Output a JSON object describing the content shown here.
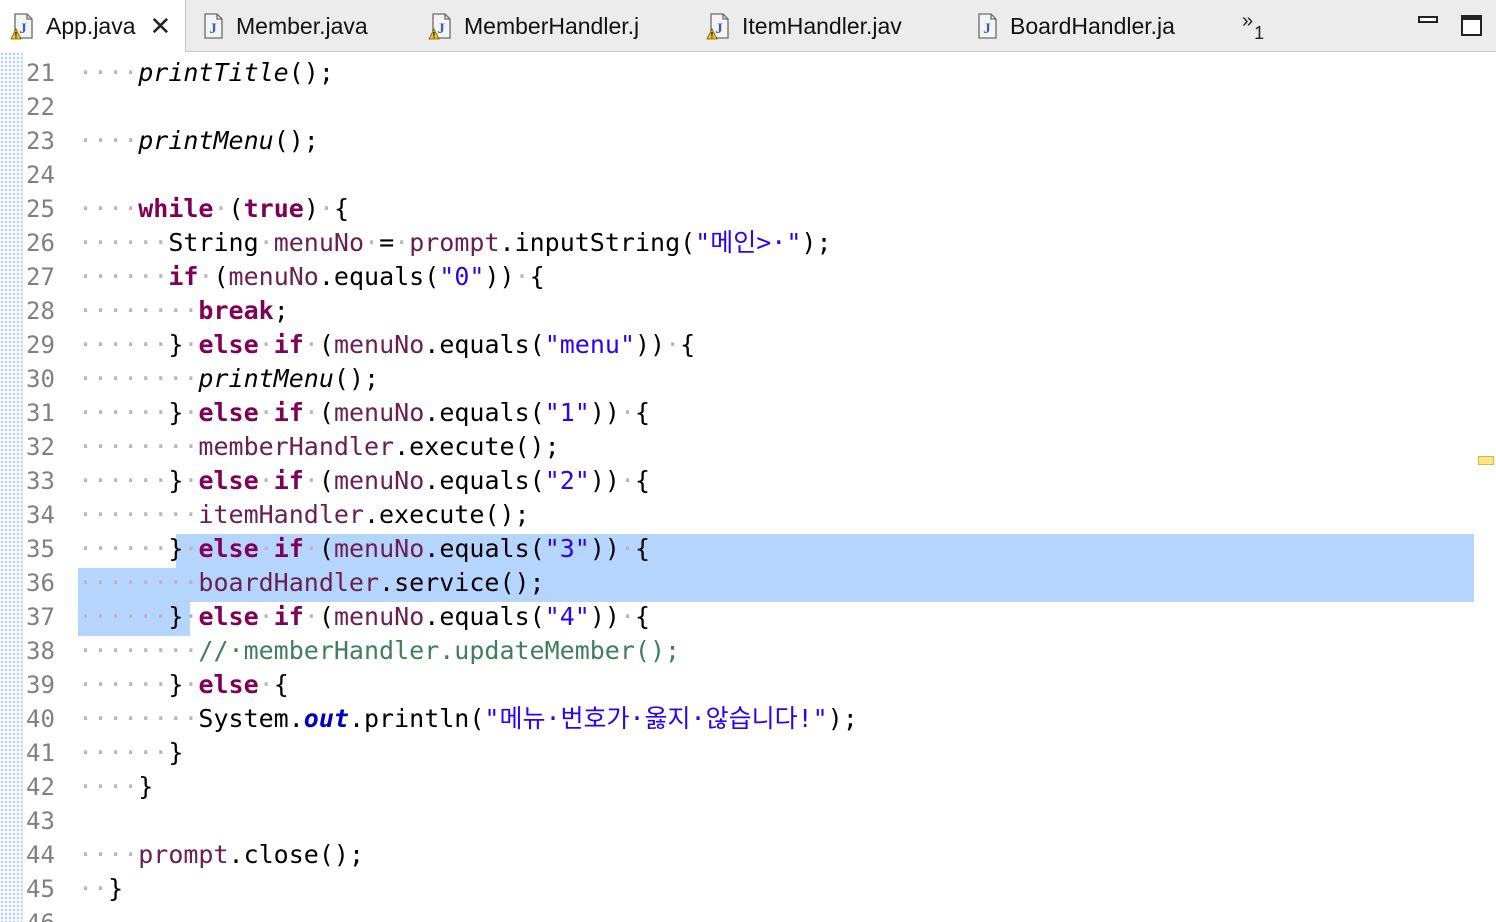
{
  "tabs": [
    {
      "label": "App.java",
      "active": true,
      "warning": true
    },
    {
      "label": "Member.java",
      "active": false,
      "warning": false
    },
    {
      "label": "MemberHandler.j",
      "active": false,
      "warning": true
    },
    {
      "label": "ItemHandler.jav",
      "active": false,
      "warning": true
    },
    {
      "label": "BoardHandler.ja",
      "active": false,
      "warning": false
    }
  ],
  "tab_overflow": {
    "symbol": "»",
    "count": "1"
  },
  "icons": {
    "java_file": "java-file-icon",
    "warning": "warning-overlay-icon",
    "close": "close-icon",
    "minimize": "minimize-icon",
    "maximize": "maximize-icon"
  },
  "colors": {
    "keyword": "#7f0055",
    "string": "#2a00ff",
    "comment": "#3f7f5f",
    "field": "#6a1f4f",
    "selection": "#b5d5ff"
  },
  "lines": [
    {
      "num": "21",
      "tokens": [
        [
          "ws",
          "····"
        ],
        [
          "ital",
          "printTitle"
        ],
        [
          "",
          "();"
        ]
      ]
    },
    {
      "num": "22",
      "tokens": []
    },
    {
      "num": "23",
      "tokens": [
        [
          "ws",
          "····"
        ],
        [
          "ital",
          "printMenu"
        ],
        [
          "",
          "();"
        ]
      ]
    },
    {
      "num": "24",
      "tokens": []
    },
    {
      "num": "25",
      "tokens": [
        [
          "ws",
          "····"
        ],
        [
          "kw",
          "while"
        ],
        [
          "ws",
          "·"
        ],
        [
          "",
          "("
        ],
        [
          "kw",
          "true"
        ],
        [
          "",
          ")"
        ],
        [
          "ws",
          "·"
        ],
        [
          "",
          "{"
        ]
      ]
    },
    {
      "num": "26",
      "tokens": [
        [
          "ws",
          "······"
        ],
        [
          "",
          "String"
        ],
        [
          "ws",
          "·"
        ],
        [
          "fld",
          "menuNo"
        ],
        [
          "ws",
          "·"
        ],
        [
          "",
          "="
        ],
        [
          "ws",
          "·"
        ],
        [
          "fld",
          "prompt"
        ],
        [
          "",
          ".inputString("
        ],
        [
          "str",
          "\"메인>·\""
        ],
        [
          "",
          ");"
        ]
      ]
    },
    {
      "num": "27",
      "tokens": [
        [
          "ws",
          "······"
        ],
        [
          "kw",
          "if"
        ],
        [
          "ws",
          "·"
        ],
        [
          "",
          "("
        ],
        [
          "fld",
          "menuNo"
        ],
        [
          "",
          ".equals("
        ],
        [
          "str",
          "\"0\""
        ],
        [
          "",
          "))"
        ],
        [
          "ws",
          "·"
        ],
        [
          "",
          "{"
        ]
      ]
    },
    {
      "num": "28",
      "tokens": [
        [
          "ws",
          "········"
        ],
        [
          "kw",
          "break"
        ],
        [
          "",
          ";"
        ]
      ]
    },
    {
      "num": "29",
      "tokens": [
        [
          "ws",
          "······"
        ],
        [
          "",
          "}"
        ],
        [
          "ws",
          "·"
        ],
        [
          "kw",
          "else"
        ],
        [
          "ws",
          "·"
        ],
        [
          "kw",
          "if"
        ],
        [
          "ws",
          "·"
        ],
        [
          "",
          "("
        ],
        [
          "fld",
          "menuNo"
        ],
        [
          "",
          ".equals("
        ],
        [
          "str",
          "\"menu\""
        ],
        [
          "",
          "))"
        ],
        [
          "ws",
          "·"
        ],
        [
          "",
          "{"
        ]
      ]
    },
    {
      "num": "30",
      "tokens": [
        [
          "ws",
          "········"
        ],
        [
          "ital",
          "printMenu"
        ],
        [
          "",
          "();"
        ]
      ]
    },
    {
      "num": "31",
      "tokens": [
        [
          "ws",
          "······"
        ],
        [
          "",
          "}"
        ],
        [
          "ws",
          "·"
        ],
        [
          "kw",
          "else"
        ],
        [
          "ws",
          "·"
        ],
        [
          "kw",
          "if"
        ],
        [
          "ws",
          "·"
        ],
        [
          "",
          "("
        ],
        [
          "fld",
          "menuNo"
        ],
        [
          "",
          ".equals("
        ],
        [
          "str",
          "\"1\""
        ],
        [
          "",
          "))"
        ],
        [
          "ws",
          "·"
        ],
        [
          "",
          "{"
        ]
      ]
    },
    {
      "num": "32",
      "tokens": [
        [
          "ws",
          "········"
        ],
        [
          "fld",
          "memberHandler"
        ],
        [
          "",
          ".execute();"
        ]
      ]
    },
    {
      "num": "33",
      "tokens": [
        [
          "ws",
          "······"
        ],
        [
          "",
          "}"
        ],
        [
          "ws",
          "·"
        ],
        [
          "kw",
          "else"
        ],
        [
          "ws",
          "·"
        ],
        [
          "kw",
          "if"
        ],
        [
          "ws",
          "·"
        ],
        [
          "",
          "("
        ],
        [
          "fld",
          "menuNo"
        ],
        [
          "",
          ".equals("
        ],
        [
          "str",
          "\"2\""
        ],
        [
          "",
          "))"
        ],
        [
          "ws",
          "·"
        ],
        [
          "",
          "{"
        ]
      ]
    },
    {
      "num": "34",
      "tokens": [
        [
          "ws",
          "········"
        ],
        [
          "fld",
          "itemHandler"
        ],
        [
          "",
          ".execute();"
        ]
      ]
    },
    {
      "num": "35",
      "tokens": [
        [
          "ws",
          "······"
        ],
        [
          "",
          "}"
        ],
        [
          "ws",
          "·"
        ],
        [
          "kw",
          "else"
        ],
        [
          "ws",
          "·"
        ],
        [
          "kw",
          "if"
        ],
        [
          "ws",
          "·"
        ],
        [
          "",
          "("
        ],
        [
          "fld",
          "menuNo"
        ],
        [
          "",
          ".equals("
        ],
        [
          "str",
          "\"3\""
        ],
        [
          "",
          "))"
        ],
        [
          "ws",
          "·"
        ],
        [
          "",
          "{"
        ]
      ]
    },
    {
      "num": "36",
      "tokens": [
        [
          "ws",
          "········"
        ],
        [
          "fld",
          "boardHandler"
        ],
        [
          "",
          ".service();"
        ]
      ]
    },
    {
      "num": "37",
      "tokens": [
        [
          "ws",
          "······"
        ],
        [
          "",
          "}"
        ],
        [
          "ws",
          "·"
        ],
        [
          "kw",
          "else"
        ],
        [
          "ws",
          "·"
        ],
        [
          "kw",
          "if"
        ],
        [
          "ws",
          "·"
        ],
        [
          "",
          "("
        ],
        [
          "fld",
          "menuNo"
        ],
        [
          "",
          ".equals("
        ],
        [
          "str",
          "\"4\""
        ],
        [
          "",
          "))"
        ],
        [
          "ws",
          "·"
        ],
        [
          "",
          "{"
        ]
      ]
    },
    {
      "num": "38",
      "tokens": [
        [
          "ws",
          "········"
        ],
        [
          "cmt",
          "//·memberHandler.updateMember();"
        ]
      ]
    },
    {
      "num": "39",
      "tokens": [
        [
          "ws",
          "······"
        ],
        [
          "",
          "}"
        ],
        [
          "ws",
          "·"
        ],
        [
          "kw",
          "else"
        ],
        [
          "ws",
          "·"
        ],
        [
          "",
          "{"
        ]
      ]
    },
    {
      "num": "40",
      "tokens": [
        [
          "ws",
          "········"
        ],
        [
          "",
          "System."
        ],
        [
          "static-out",
          "out"
        ],
        [
          "",
          ".println("
        ],
        [
          "str",
          "\"메뉴·번호가·옳지·않습니다!\""
        ],
        [
          "",
          ");"
        ]
      ]
    },
    {
      "num": "41",
      "tokens": [
        [
          "ws",
          "······"
        ],
        [
          "",
          "}"
        ]
      ]
    },
    {
      "num": "42",
      "tokens": [
        [
          "ws",
          "····"
        ],
        [
          "",
          "}"
        ]
      ]
    },
    {
      "num": "43",
      "tokens": []
    },
    {
      "num": "44",
      "tokens": [
        [
          "ws",
          "····"
        ],
        [
          "fld",
          "prompt"
        ],
        [
          "",
          ".close();"
        ]
      ]
    },
    {
      "num": "45",
      "tokens": [
        [
          "ws",
          "··"
        ],
        [
          "",
          "}"
        ]
      ]
    },
    {
      "num": "46",
      "tokens": []
    }
  ]
}
